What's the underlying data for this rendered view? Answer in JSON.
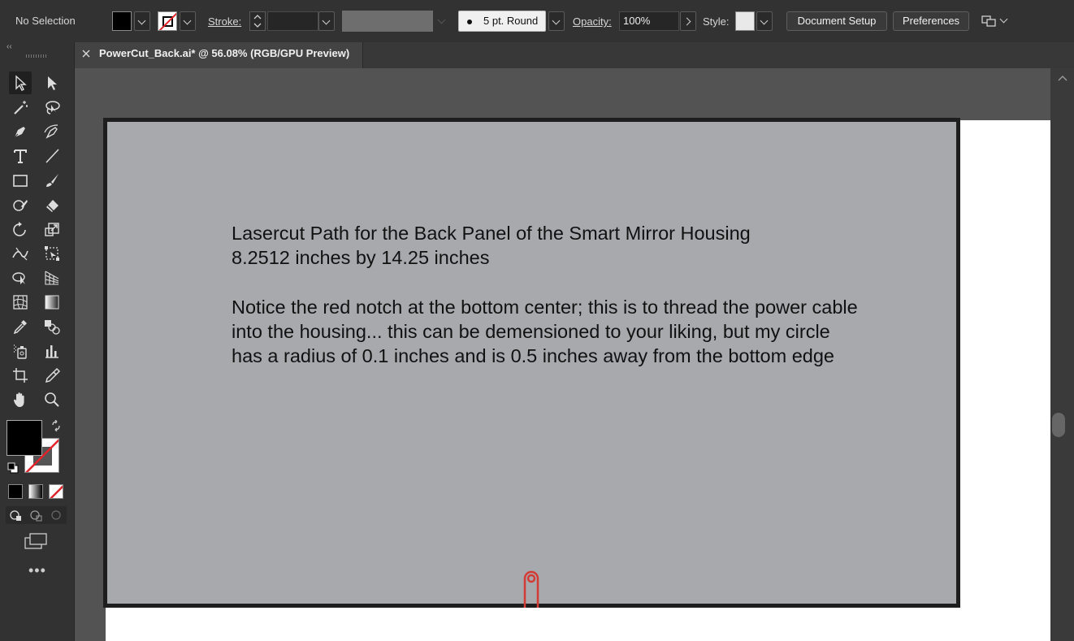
{
  "control_bar": {
    "selection_label": "No Selection",
    "stroke_label": "Stroke:",
    "brush_label": "5 pt. Round",
    "opacity_label": "Opacity:",
    "opacity_value": "100%",
    "style_label": "Style:",
    "document_setup_label": "Document Setup",
    "preferences_label": "Preferences"
  },
  "document_tab": {
    "title": "PowerCut_Back.ai* @ 56.08% (RGB/GPU Preview)"
  },
  "artboard": {
    "text_lines": [
      "Lasercut Path for the Back Panel of the Smart Mirror Housing",
      "8.2512 inches by 14.25 inches",
      "Notice the red notch at the bottom center; this is to thread the power cable",
      "into the housing... this can be demensioned to your liking, but my circle",
      "has a radius of 0.1 inches and is 0.5 inches away from the bottom edge"
    ]
  },
  "tools": [
    {
      "name": "selection-tool-icon"
    },
    {
      "name": "direct-selection-tool-icon"
    },
    {
      "name": "magic-wand-tool-icon"
    },
    {
      "name": "lasso-tool-icon"
    },
    {
      "name": "pen-tool-icon"
    },
    {
      "name": "curvature-tool-icon"
    },
    {
      "name": "type-tool-icon"
    },
    {
      "name": "line-segment-tool-icon"
    },
    {
      "name": "rectangle-tool-icon"
    },
    {
      "name": "paintbrush-tool-icon"
    },
    {
      "name": "shaper-tool-icon"
    },
    {
      "name": "eraser-tool-icon"
    },
    {
      "name": "rotate-tool-icon"
    },
    {
      "name": "scale-tool-icon"
    },
    {
      "name": "width-tool-icon"
    },
    {
      "name": "free-transform-tool-icon"
    },
    {
      "name": "shape-builder-tool-icon"
    },
    {
      "name": "perspective-grid-tool-icon"
    },
    {
      "name": "mesh-tool-icon"
    },
    {
      "name": "gradient-tool-icon"
    },
    {
      "name": "eyedropper-tool-icon"
    },
    {
      "name": "blend-tool-icon"
    },
    {
      "name": "symbol-sprayer-tool-icon"
    },
    {
      "name": "column-graph-tool-icon"
    },
    {
      "name": "artboard-tool-icon"
    },
    {
      "name": "slice-tool-icon"
    },
    {
      "name": "hand-tool-icon"
    },
    {
      "name": "zoom-tool-icon"
    }
  ],
  "colors": {
    "fill": "#000000",
    "stroke": "none",
    "notch": "#d33b34",
    "panel_gray": "#a8a9ad"
  }
}
